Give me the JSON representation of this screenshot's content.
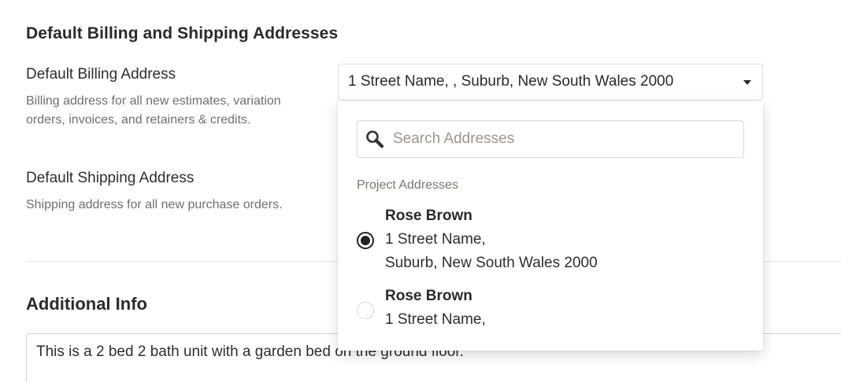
{
  "section": {
    "title": "Default Billing and Shipping Addresses"
  },
  "billing": {
    "label": "Default Billing Address",
    "help": "Billing address for all new estimates, variation orders, invoices, and retainers & credits.",
    "selected_value": "1 Street Name, , Suburb, New South Wales 2000"
  },
  "shipping": {
    "label": "Default Shipping Address",
    "help": "Shipping address for all new purchase orders."
  },
  "additional_info": {
    "title": "Additional Info",
    "text": "This is a 2 bed 2 bath unit with a garden bed on the ground floor."
  },
  "dropdown": {
    "search_placeholder": "Search Addresses",
    "group_label": "Project Addresses",
    "options": [
      {
        "name": "Rose Brown",
        "line1": "1 Street Name,",
        "line2": "Suburb, New South Wales 2000",
        "selected": true
      },
      {
        "name": "Rose Brown",
        "line1": "1 Street Name,",
        "selected": false
      }
    ]
  },
  "icons": {
    "search": "search-icon",
    "caret": "caret-down-icon"
  }
}
